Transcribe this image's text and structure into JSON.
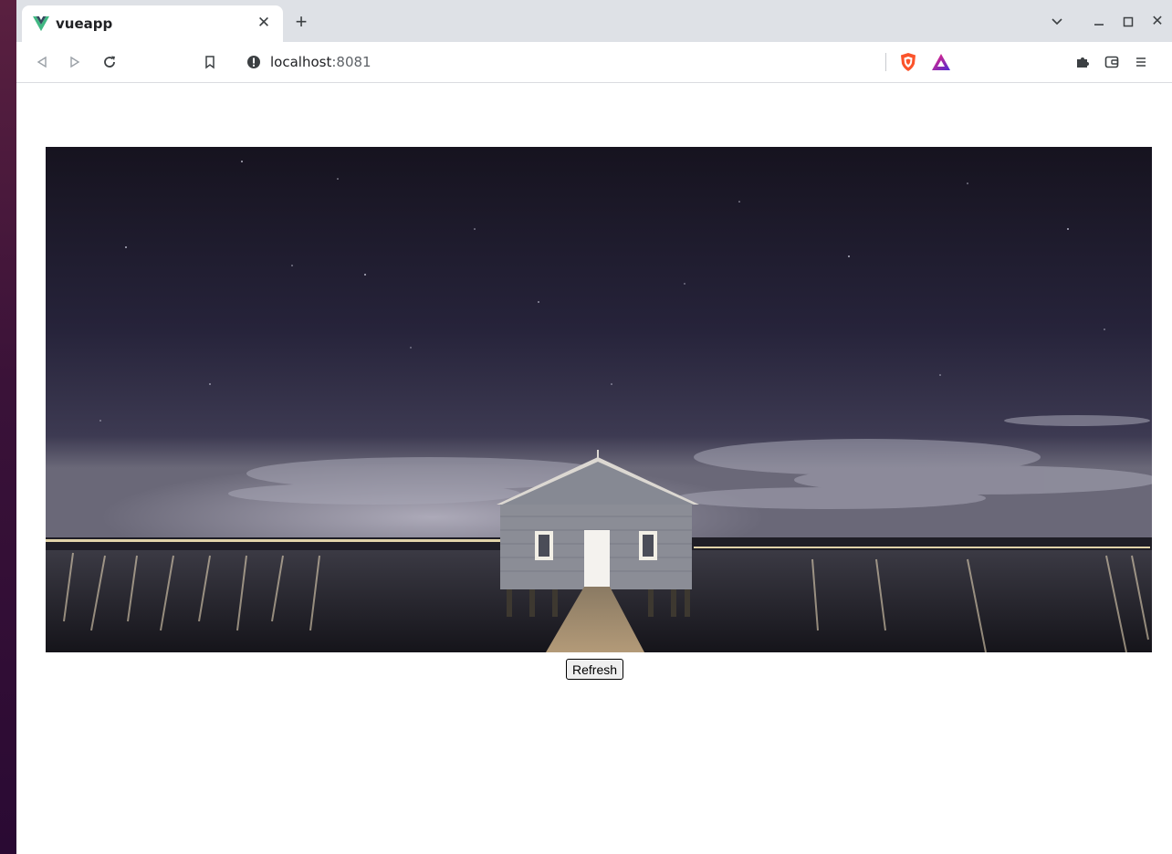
{
  "tab": {
    "title": "vueapp"
  },
  "address_bar": {
    "host": "localhost",
    "port": ":8081"
  },
  "page": {
    "refresh_label": "Refresh"
  },
  "icons": {
    "favicon": "vue-logo-icon",
    "info": "info-icon",
    "bookmark": "bookmark-icon",
    "shield": "brave-shield-icon",
    "rewards": "brave-rewards-icon",
    "extensions": "puzzle-piece-icon",
    "wallet": "wallet-icon",
    "menu": "hamburger-menu-icon"
  },
  "colors": {
    "tabstrip": "#dee1e6",
    "vue_green": "#41b883",
    "vue_dark": "#35495e",
    "brave_orange": "#fb542b"
  }
}
